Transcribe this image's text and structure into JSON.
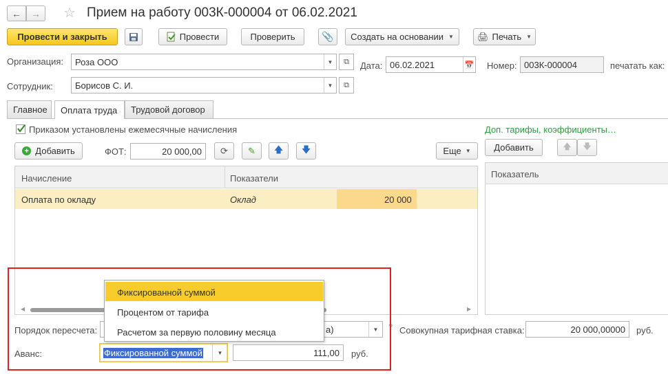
{
  "title": "Прием на работу 003К-000004 от 06.02.2021",
  "nav": {
    "back_icon": "arrow-left-icon",
    "forward_icon": "arrow-right-icon",
    "favorite_icon": "star-icon"
  },
  "toolbar": {
    "post_close": "Провести и закрыть",
    "post": "Провести",
    "check": "Проверить",
    "create_based": "Создать на основании",
    "print": "Печать"
  },
  "header": {
    "org_label": "Организация:",
    "org_value": "Роза ООО",
    "date_label": "Дата:",
    "date_value": "06.02.2021",
    "number_label": "Номер:",
    "number_value": "003К-000004",
    "print_as_label": "печатать как:",
    "employee_label": "Сотрудник:",
    "employee_value": "Борисов С. И."
  },
  "tabs": [
    {
      "label": "Главное"
    },
    {
      "label": "Оплата труда"
    },
    {
      "label": "Трудовой договор"
    }
  ],
  "pay": {
    "checkbox_label": "Приказом установлены ежемесячные начисления",
    "add": "Добавить",
    "fot_label": "ФОТ:",
    "fot_value": "20 000,00",
    "more": "Еще",
    "col_accrual": "Начисление",
    "col_indicators": "Показатели",
    "row_accrual": "Оплата по окладу",
    "row_indicator": "Оклад",
    "row_value": "20 000"
  },
  "right_panel": {
    "link": "Доп. тарифы, коэффициенты…",
    "add": "Добавить",
    "col_indicator": "Показатель"
  },
  "bottom": {
    "recalc_label": "Порядок пересчета:",
    "recalc_value_tail": "а)",
    "total_rate_label": "Совокупная тарифная ставка:",
    "total_rate_value": "20 000,00000",
    "rub1": "руб.",
    "advance_label": "Аванс:",
    "advance_value": "Фиксированной суммой",
    "advance_amount": "111,00",
    "rub2": "руб."
  },
  "dropdown": {
    "options": [
      "Фиксированной суммой",
      "Процентом от тарифа",
      "Расчетом за первую половину месяца"
    ]
  },
  "colors": {
    "highlight_box": "#e02020",
    "selected_option": "#f8cc2a",
    "row_selected": "#fbeec3",
    "link": "#2e9b3e"
  }
}
